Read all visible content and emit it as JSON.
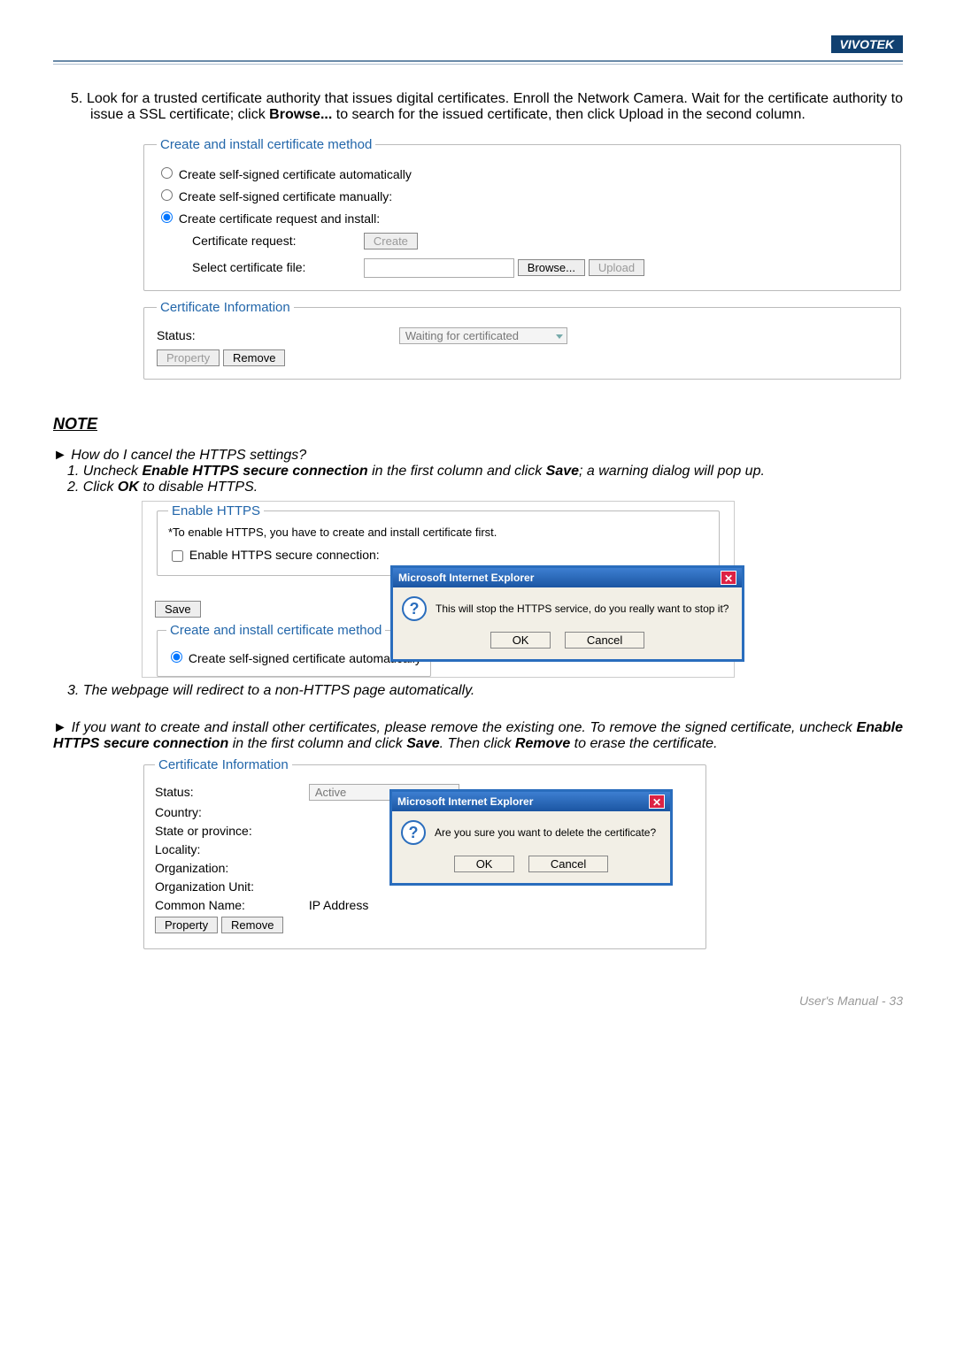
{
  "brand": "VIVOTEK",
  "step5_num": "5.",
  "step5_text_a": "Look for a trusted certificate authority that issues digital certificates. Enroll the Network Camera. Wait for the certificate authority to issue a SSL certificate; click ",
  "step5_browse": "Browse...",
  "step5_text_b": " to search for the issued certificate, then click Upload in the second column.",
  "fs1": {
    "legend": "Create and install certificate method",
    "opt1": "Create self-signed certificate automatically",
    "opt2": "Create self-signed certificate manually:",
    "opt3": "Create certificate request and install:",
    "cert_req_label": "Certificate request:",
    "create_btn": "Create",
    "select_file_label": "Select certificate file:",
    "browse_btn": "Browse...",
    "upload_btn": "Upload"
  },
  "fs2": {
    "legend": "Certificate Information",
    "status_label": "Status:",
    "status_value": "Waiting for certificated",
    "property_btn": "Property",
    "remove_btn": "Remove"
  },
  "note_header": "NOTE",
  "q1_lead": "► How do I cancel the HTTPS settings?",
  "q1_li1_a": "Uncheck ",
  "q1_li1_b": "Enable HTTPS secure connection",
  "q1_li1_c": " in the first column and click ",
  "q1_li1_d": "Save",
  "q1_li1_e": "; a warning dialog will pop up.",
  "q1_li2_a": "Click ",
  "q1_li2_b": "OK",
  "q1_li2_c": " to disable HTTPS.",
  "enable_fs": {
    "legend": "Enable HTTPS",
    "hint": "*To enable HTTPS, you have to create and install certificate first.",
    "cb_label": "Enable HTTPS secure connection:",
    "save_btn": "Save",
    "sub_legend": "Create and install certificate method",
    "sub_opt1": "Create self-signed certificate automatically"
  },
  "dlg1": {
    "title": "Microsoft Internet Explorer",
    "msg": "This will stop the HTTPS service, do you really want to stop it?",
    "ok": "OK",
    "cancel": "Cancel"
  },
  "q1_li3": "3. The webpage will redirect to a non-HTTPS page automatically.",
  "q2_a": "► If you want to create and install other certificates, please remove the existing one. To remove the signed certificate, uncheck ",
  "q2_b": "Enable HTTPS secure connection",
  "q2_c": " in the first column and click ",
  "q2_d": "Save",
  "q2_e": ". Then click ",
  "q2_f": "Remove",
  "q2_g": " to erase the certificate.",
  "cert_info2": {
    "legend": "Certificate Information",
    "status_label": "Status:",
    "status_value": "Active",
    "country": "Country:",
    "state": "State or province:",
    "locality": "Locality:",
    "org": "Organization:",
    "org_unit": "Organization Unit:",
    "cn_label": "Common Name:",
    "cn_value": "IP Address",
    "property_btn": "Property",
    "remove_btn": "Remove"
  },
  "dlg2": {
    "title": "Microsoft Internet Explorer",
    "msg": "Are you sure you want to delete the certificate?",
    "ok": "OK",
    "cancel": "Cancel"
  },
  "footer": "User's Manual - 33"
}
